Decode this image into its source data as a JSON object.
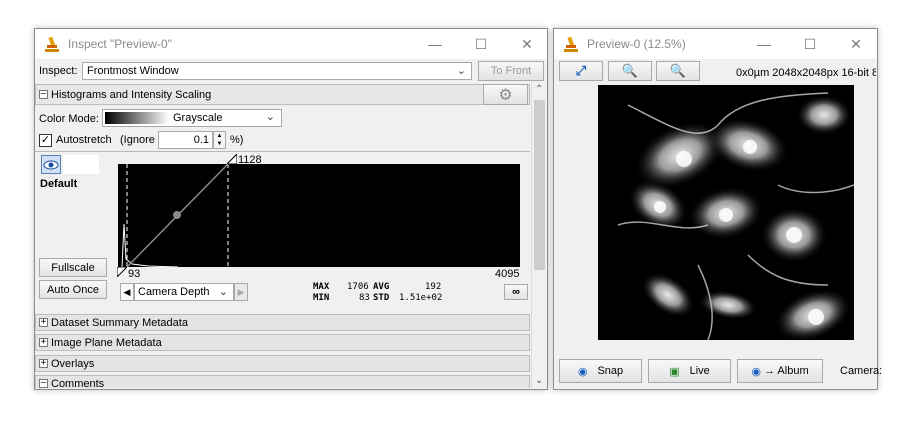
{
  "inspect": {
    "title": "Inspect \"Preview-0\"",
    "inspect_label": "Inspect:",
    "inspect_value": "Frontmost Window",
    "to_front": "To Front",
    "hist_section": "Histograms and Intensity Scaling",
    "color_mode_label": "Color Mode:",
    "color_mode_value": "Grayscale",
    "autostretch_label": "Autostretch",
    "ignore_label": "(Ignore",
    "ignore_value": "0.1",
    "percent_label": "%)",
    "default_label": "Default",
    "fullscale": "Fullscale",
    "auto_once": "Auto Once",
    "max_value": "1128",
    "min_value": "93",
    "axis_max": "4095",
    "camera_depth": "Camera Depth",
    "stats": {
      "max_label": "MAX",
      "max": "1706",
      "min_label": "MIN",
      "min": "83",
      "avg_label": "AVG",
      "avg": "192",
      "std_label": "STD",
      "std": "1.51e+02"
    },
    "sections": [
      "Dataset Summary Metadata",
      "Image Plane Metadata",
      "Overlays",
      "Comments"
    ]
  },
  "preview": {
    "title": "Preview-0 (12.5%)",
    "info": "0x0µm  2048x2048px  16-bit 8",
    "snap": "Snap",
    "live": "Live",
    "album": "→ Album",
    "camera": "Camera:"
  }
}
